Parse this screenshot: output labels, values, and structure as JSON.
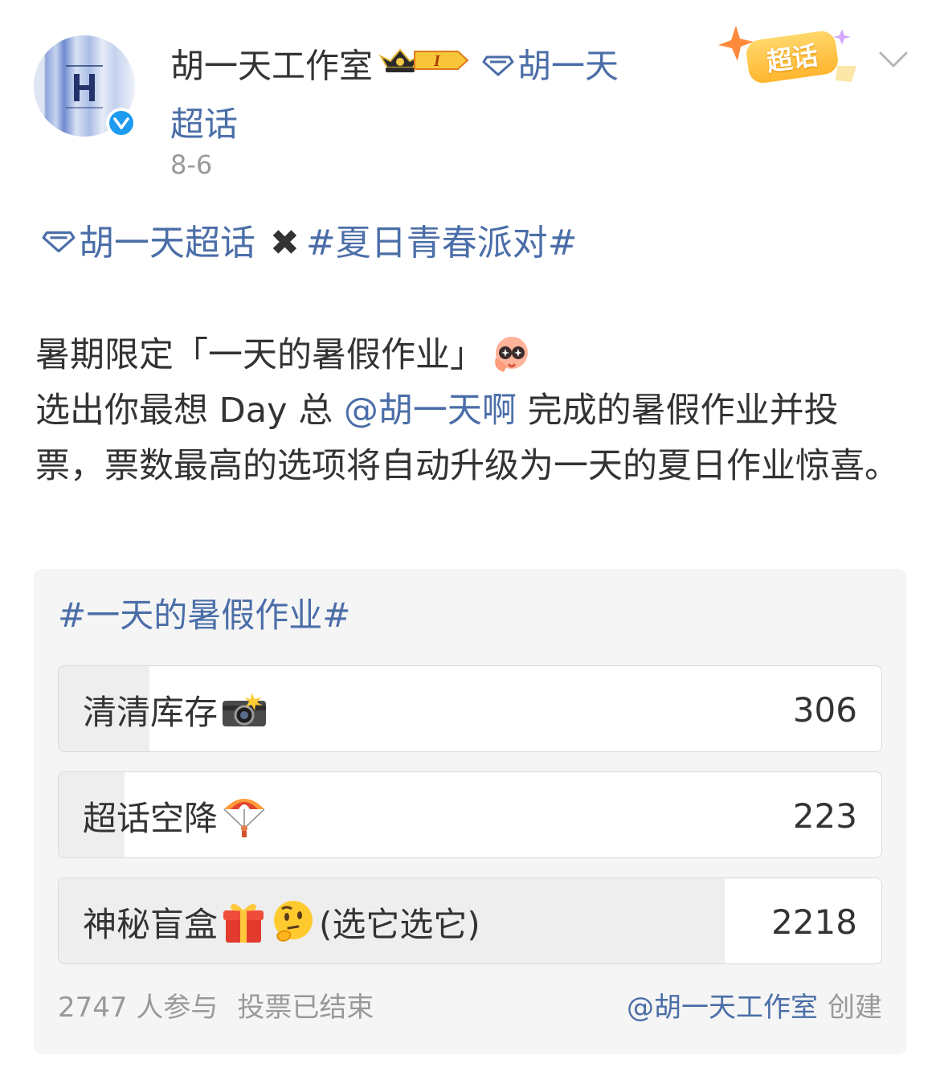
{
  "author": {
    "name": "胡一天工作室",
    "supertopic_link": "胡一天超话",
    "date": "8-6",
    "badge_level": "I",
    "chaohua_badge": "超话"
  },
  "post": {
    "tag_supertopic": "胡一天超话",
    "tag_separator": "✖",
    "hashtag": "#夏日青春派对#",
    "line1": "暑期限定「一天的暑假作业」",
    "line2_prefix": "选出你最想 Day 总 ",
    "mention": "@胡一天啊",
    "line2_suffix": " 完成的暑假作业并投票，票数最高的选项将自动升级为一天的夏日作业惊喜。"
  },
  "poll": {
    "title": "#一天的暑假作业#",
    "total_votes": 2747,
    "options": [
      {
        "label": "清清库存",
        "emoji": "camera-flash-icon",
        "suffix": "",
        "votes": 306,
        "percent": 11
      },
      {
        "label": "超话空降",
        "emoji": "parachute-icon",
        "suffix": "",
        "votes": 223,
        "percent": 8
      },
      {
        "label": "神秘盲盒",
        "emoji": "gift-icon",
        "emoji2": "thinking-face-icon",
        "suffix": "(选它选它)",
        "votes": 2218,
        "percent": 81
      }
    ],
    "participants": "2747 人参与",
    "status": "投票已结束",
    "creator": "@胡一天工作室",
    "created_label": "创建"
  },
  "colors": {
    "link": "#4b6ea8",
    "text": "#333333",
    "muted": "#999999",
    "card_bg": "#f5f5f5",
    "fill": "#eeeeee",
    "verified": "#1e9bf0"
  }
}
